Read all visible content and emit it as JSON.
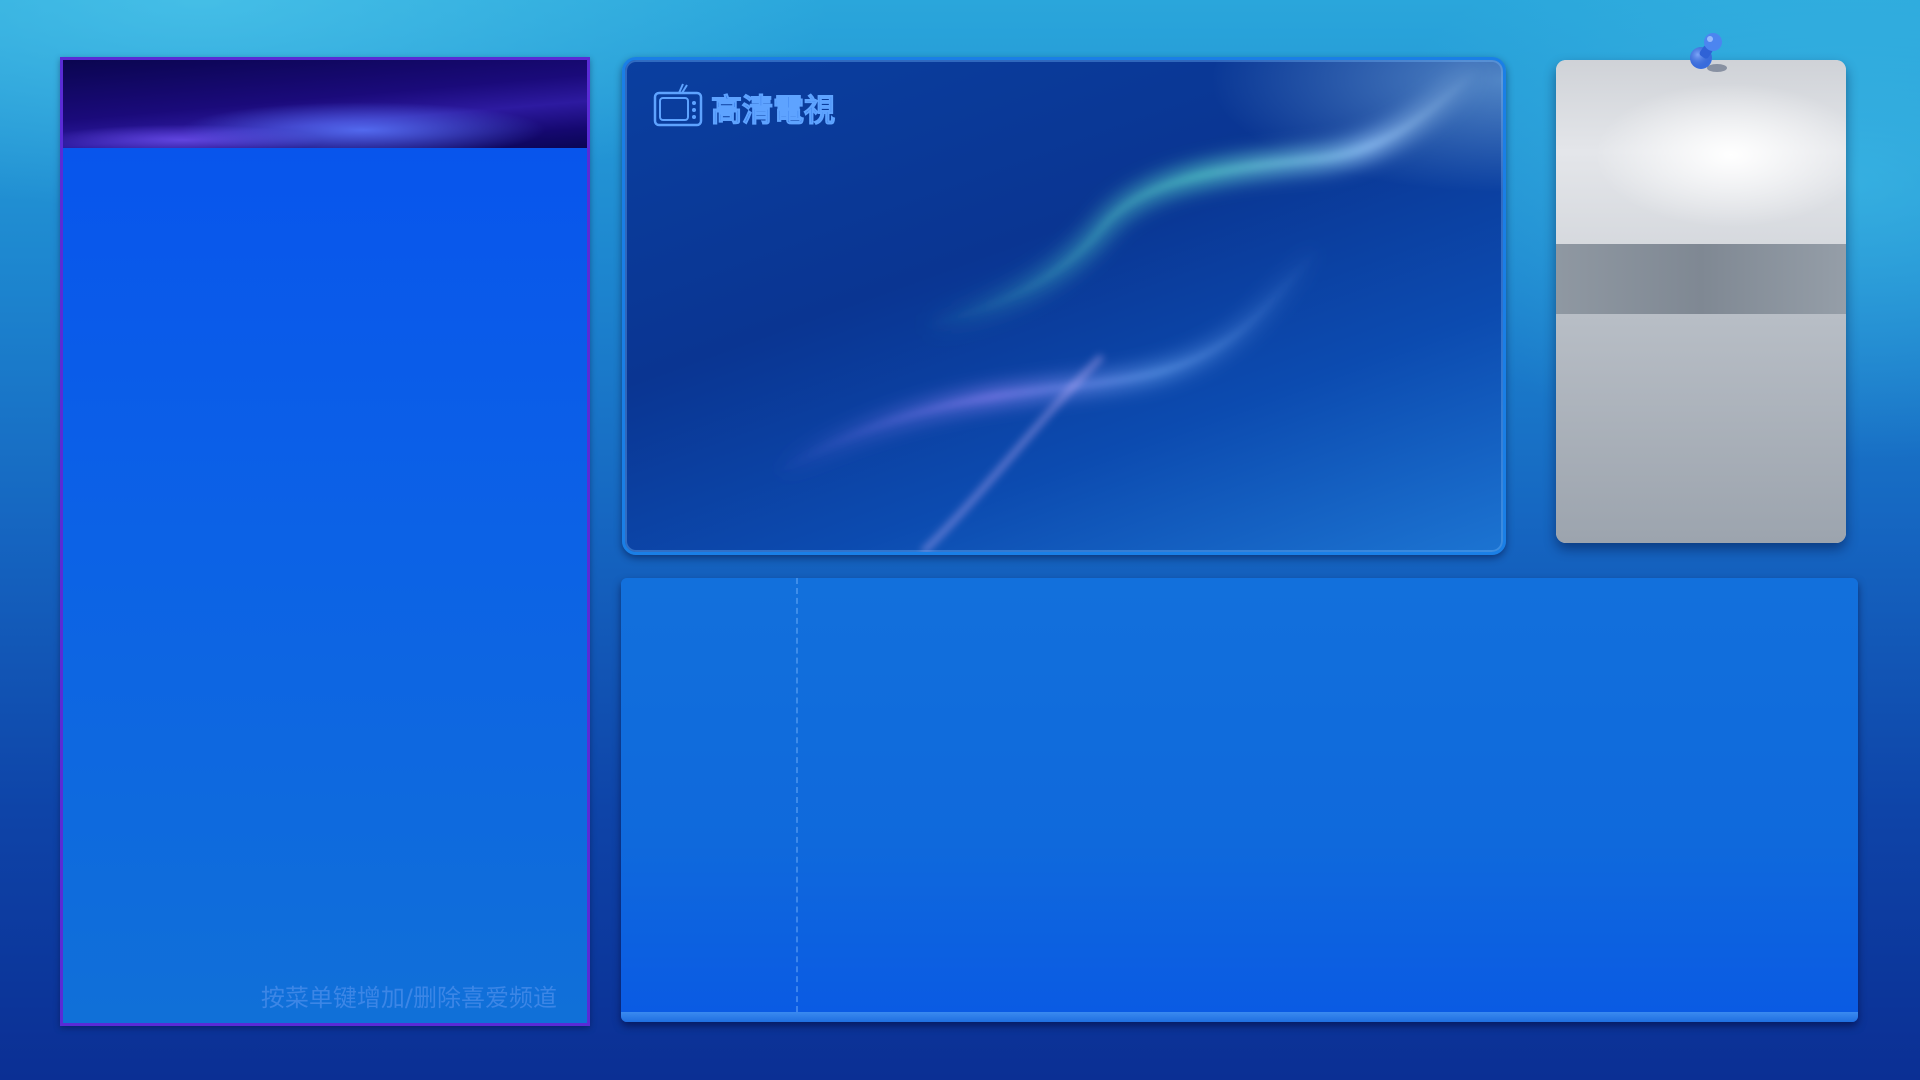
{
  "favorites_panel": {
    "hint": "按菜单键增加/删除喜爱频道"
  },
  "video_panel": {
    "logo_icon": "tv-icon",
    "logo_text": "高清電視"
  },
  "memo_card": {
    "pin_icon": "pushpin-icon"
  },
  "guide_panel": {},
  "colors": {
    "background_top": "#2aa6db",
    "background_bottom": "#0b2f94",
    "panel_blue": "#0c62e6",
    "panel_border": "#5a2bd6",
    "hint_text": "#3c86e6"
  }
}
